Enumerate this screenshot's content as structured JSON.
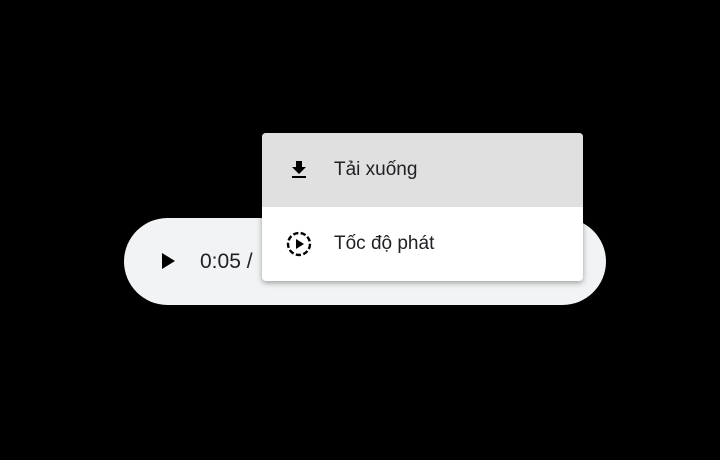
{
  "player": {
    "time_display": "0:05 /",
    "play_icon": "play-icon"
  },
  "menu": {
    "items": [
      {
        "label": "Tải xuống",
        "icon": "download-icon",
        "highlighted": true
      },
      {
        "label": "Tốc độ phát",
        "icon": "playback-speed-icon",
        "highlighted": false
      }
    ]
  },
  "colors": {
    "background": "#000000",
    "player_background": "#f1f3f4",
    "menu_background": "#ffffff",
    "menu_highlight": "#e0e0e0",
    "text": "#202124"
  }
}
